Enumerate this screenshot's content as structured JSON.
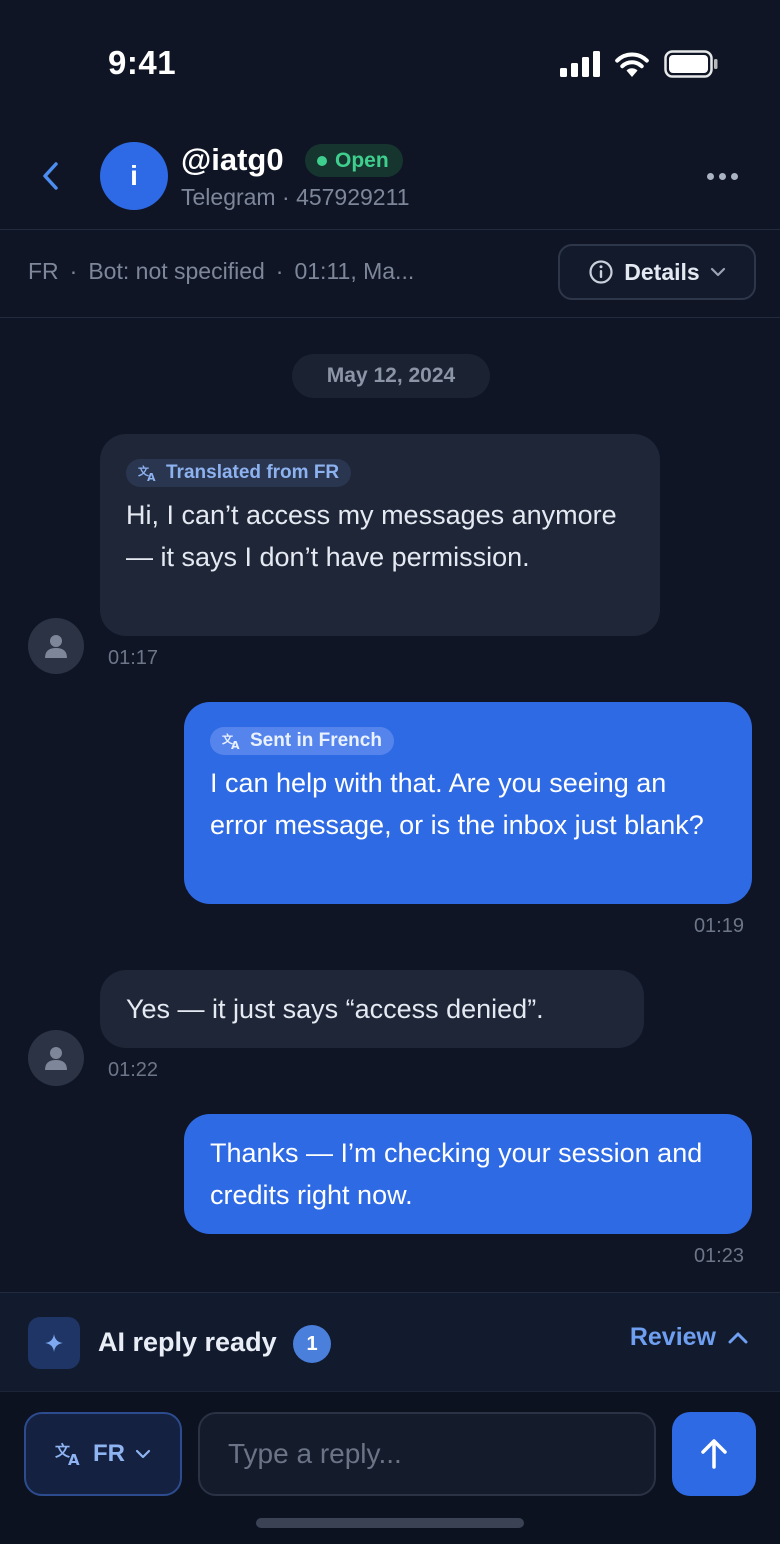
{
  "status_bar": {
    "time": "9:41"
  },
  "header": {
    "avatar_initial": "i",
    "handle": "@iatg0",
    "status": "Open",
    "channel": "Telegram",
    "separator": "·",
    "user_id": "457929211"
  },
  "meta": {
    "language": "FR",
    "bot": "Bot: not specified",
    "time": "01:11, Ma...",
    "separator": "·",
    "details_label": "Details"
  },
  "chat": {
    "date": "May 12, 2024",
    "messages": [
      {
        "direction": "in",
        "tag": "Translated from FR",
        "text": "Hi, I can’t access my messages anymore — it says I don’t have permission.",
        "time": "01:17"
      },
      {
        "direction": "out",
        "tag": "Sent in French",
        "text": "I can help with that. Are you seeing an error message, or is the inbox just blank?",
        "time": "01:19"
      },
      {
        "direction": "in",
        "tag": "",
        "text": "Yes — it just says “access denied”.",
        "time": "01:22"
      },
      {
        "direction": "out",
        "tag": "",
        "text": "Thanks — I’m checking your session and credits right now.",
        "time": "01:23"
      }
    ]
  },
  "ai_bar": {
    "label": "AI reply ready",
    "count": "1",
    "review_label": "Review"
  },
  "composer": {
    "language": "FR",
    "placeholder": "Type a reply..."
  },
  "colors": {
    "accent": "#2f6ae5",
    "online": "#3ecf8e",
    "background": "#0f1524",
    "incoming_bubble": "#1e2638"
  }
}
